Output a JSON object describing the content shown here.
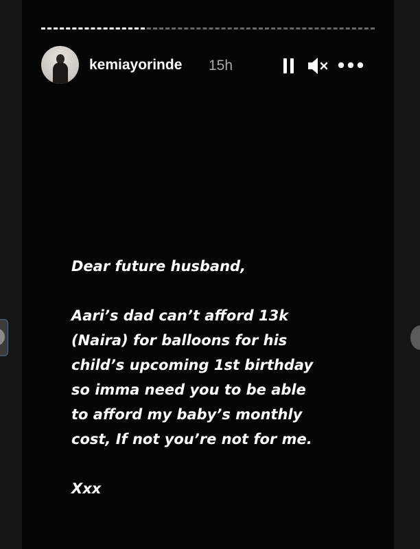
{
  "story": {
    "username": "kemiayorinde",
    "timestamp": "15h",
    "progress": 0.31
  },
  "controls": {
    "pause_icon": "pause-icon",
    "mute_icon": "speaker-muted-icon",
    "more_icon": "more-horizontal-icon"
  },
  "caption": {
    "greeting": "Dear future husband,",
    "lines": [
      "Aari’s dad can’t afford 13k",
      "(Naira) for balloons for his",
      "child’s upcoming 1st birthday",
      "so imma need you to be able",
      "to afford my baby’s monthly",
      "cost, If not you’re not for me."
    ],
    "signoff": "Xxx"
  },
  "colors": {
    "page_bg": "#151515",
    "story_bg": "#050505",
    "text": "#ffffff",
    "muted_text": "#a8a8a8"
  }
}
